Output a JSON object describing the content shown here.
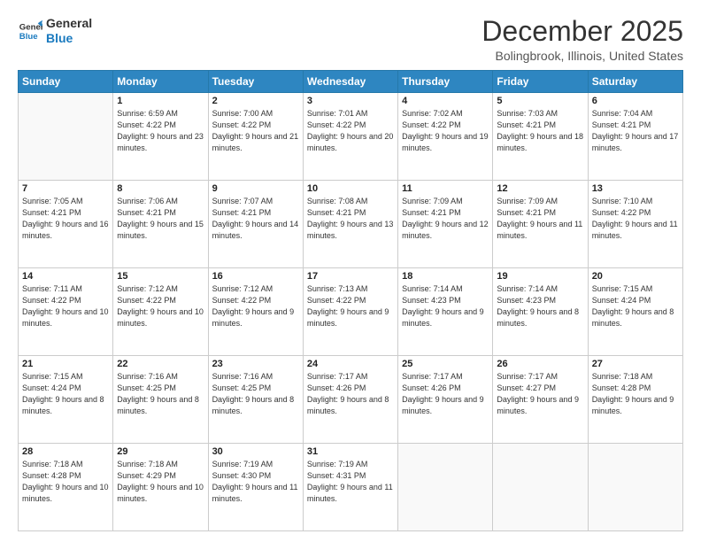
{
  "header": {
    "logo_line1": "General",
    "logo_line2": "Blue",
    "month": "December 2025",
    "location": "Bolingbrook, Illinois, United States"
  },
  "weekdays": [
    "Sunday",
    "Monday",
    "Tuesday",
    "Wednesday",
    "Thursday",
    "Friday",
    "Saturday"
  ],
  "weeks": [
    [
      {
        "num": "",
        "sunrise": "",
        "sunset": "",
        "daylight": ""
      },
      {
        "num": "1",
        "sunrise": "Sunrise: 6:59 AM",
        "sunset": "Sunset: 4:22 PM",
        "daylight": "Daylight: 9 hours and 23 minutes."
      },
      {
        "num": "2",
        "sunrise": "Sunrise: 7:00 AM",
        "sunset": "Sunset: 4:22 PM",
        "daylight": "Daylight: 9 hours and 21 minutes."
      },
      {
        "num": "3",
        "sunrise": "Sunrise: 7:01 AM",
        "sunset": "Sunset: 4:22 PM",
        "daylight": "Daylight: 9 hours and 20 minutes."
      },
      {
        "num": "4",
        "sunrise": "Sunrise: 7:02 AM",
        "sunset": "Sunset: 4:22 PM",
        "daylight": "Daylight: 9 hours and 19 minutes."
      },
      {
        "num": "5",
        "sunrise": "Sunrise: 7:03 AM",
        "sunset": "Sunset: 4:21 PM",
        "daylight": "Daylight: 9 hours and 18 minutes."
      },
      {
        "num": "6",
        "sunrise": "Sunrise: 7:04 AM",
        "sunset": "Sunset: 4:21 PM",
        "daylight": "Daylight: 9 hours and 17 minutes."
      }
    ],
    [
      {
        "num": "7",
        "sunrise": "Sunrise: 7:05 AM",
        "sunset": "Sunset: 4:21 PM",
        "daylight": "Daylight: 9 hours and 16 minutes."
      },
      {
        "num": "8",
        "sunrise": "Sunrise: 7:06 AM",
        "sunset": "Sunset: 4:21 PM",
        "daylight": "Daylight: 9 hours and 15 minutes."
      },
      {
        "num": "9",
        "sunrise": "Sunrise: 7:07 AM",
        "sunset": "Sunset: 4:21 PM",
        "daylight": "Daylight: 9 hours and 14 minutes."
      },
      {
        "num": "10",
        "sunrise": "Sunrise: 7:08 AM",
        "sunset": "Sunset: 4:21 PM",
        "daylight": "Daylight: 9 hours and 13 minutes."
      },
      {
        "num": "11",
        "sunrise": "Sunrise: 7:09 AM",
        "sunset": "Sunset: 4:21 PM",
        "daylight": "Daylight: 9 hours and 12 minutes."
      },
      {
        "num": "12",
        "sunrise": "Sunrise: 7:09 AM",
        "sunset": "Sunset: 4:21 PM",
        "daylight": "Daylight: 9 hours and 11 minutes."
      },
      {
        "num": "13",
        "sunrise": "Sunrise: 7:10 AM",
        "sunset": "Sunset: 4:22 PM",
        "daylight": "Daylight: 9 hours and 11 minutes."
      }
    ],
    [
      {
        "num": "14",
        "sunrise": "Sunrise: 7:11 AM",
        "sunset": "Sunset: 4:22 PM",
        "daylight": "Daylight: 9 hours and 10 minutes."
      },
      {
        "num": "15",
        "sunrise": "Sunrise: 7:12 AM",
        "sunset": "Sunset: 4:22 PM",
        "daylight": "Daylight: 9 hours and 10 minutes."
      },
      {
        "num": "16",
        "sunrise": "Sunrise: 7:12 AM",
        "sunset": "Sunset: 4:22 PM",
        "daylight": "Daylight: 9 hours and 9 minutes."
      },
      {
        "num": "17",
        "sunrise": "Sunrise: 7:13 AM",
        "sunset": "Sunset: 4:22 PM",
        "daylight": "Daylight: 9 hours and 9 minutes."
      },
      {
        "num": "18",
        "sunrise": "Sunrise: 7:14 AM",
        "sunset": "Sunset: 4:23 PM",
        "daylight": "Daylight: 9 hours and 9 minutes."
      },
      {
        "num": "19",
        "sunrise": "Sunrise: 7:14 AM",
        "sunset": "Sunset: 4:23 PM",
        "daylight": "Daylight: 9 hours and 8 minutes."
      },
      {
        "num": "20",
        "sunrise": "Sunrise: 7:15 AM",
        "sunset": "Sunset: 4:24 PM",
        "daylight": "Daylight: 9 hours and 8 minutes."
      }
    ],
    [
      {
        "num": "21",
        "sunrise": "Sunrise: 7:15 AM",
        "sunset": "Sunset: 4:24 PM",
        "daylight": "Daylight: 9 hours and 8 minutes."
      },
      {
        "num": "22",
        "sunrise": "Sunrise: 7:16 AM",
        "sunset": "Sunset: 4:25 PM",
        "daylight": "Daylight: 9 hours and 8 minutes."
      },
      {
        "num": "23",
        "sunrise": "Sunrise: 7:16 AM",
        "sunset": "Sunset: 4:25 PM",
        "daylight": "Daylight: 9 hours and 8 minutes."
      },
      {
        "num": "24",
        "sunrise": "Sunrise: 7:17 AM",
        "sunset": "Sunset: 4:26 PM",
        "daylight": "Daylight: 9 hours and 8 minutes."
      },
      {
        "num": "25",
        "sunrise": "Sunrise: 7:17 AM",
        "sunset": "Sunset: 4:26 PM",
        "daylight": "Daylight: 9 hours and 9 minutes."
      },
      {
        "num": "26",
        "sunrise": "Sunrise: 7:17 AM",
        "sunset": "Sunset: 4:27 PM",
        "daylight": "Daylight: 9 hours and 9 minutes."
      },
      {
        "num": "27",
        "sunrise": "Sunrise: 7:18 AM",
        "sunset": "Sunset: 4:28 PM",
        "daylight": "Daylight: 9 hours and 9 minutes."
      }
    ],
    [
      {
        "num": "28",
        "sunrise": "Sunrise: 7:18 AM",
        "sunset": "Sunset: 4:28 PM",
        "daylight": "Daylight: 9 hours and 10 minutes."
      },
      {
        "num": "29",
        "sunrise": "Sunrise: 7:18 AM",
        "sunset": "Sunset: 4:29 PM",
        "daylight": "Daylight: 9 hours and 10 minutes."
      },
      {
        "num": "30",
        "sunrise": "Sunrise: 7:19 AM",
        "sunset": "Sunset: 4:30 PM",
        "daylight": "Daylight: 9 hours and 11 minutes."
      },
      {
        "num": "31",
        "sunrise": "Sunrise: 7:19 AM",
        "sunset": "Sunset: 4:31 PM",
        "daylight": "Daylight: 9 hours and 11 minutes."
      },
      {
        "num": "",
        "sunrise": "",
        "sunset": "",
        "daylight": ""
      },
      {
        "num": "",
        "sunrise": "",
        "sunset": "",
        "daylight": ""
      },
      {
        "num": "",
        "sunrise": "",
        "sunset": "",
        "daylight": ""
      }
    ]
  ]
}
